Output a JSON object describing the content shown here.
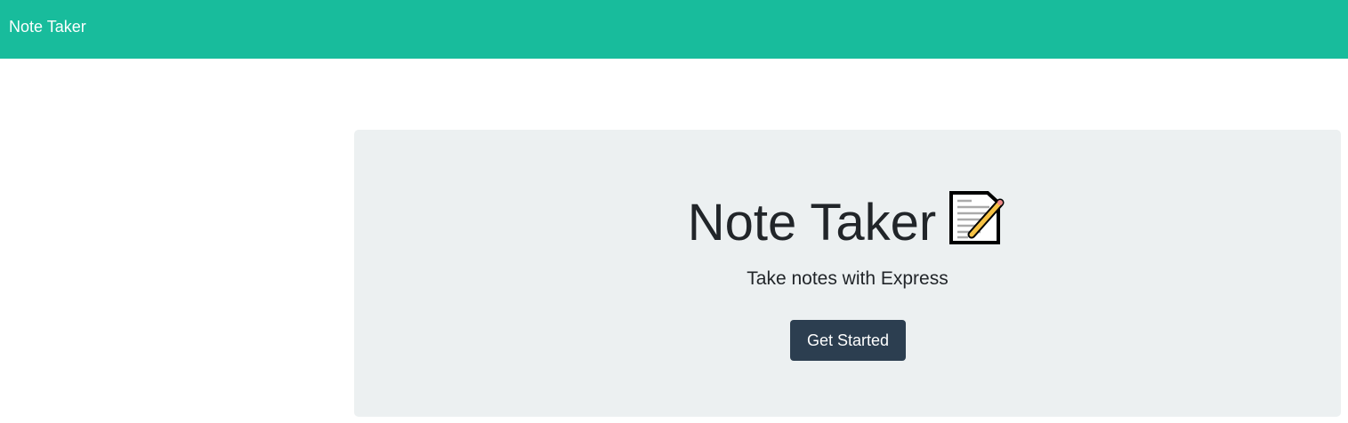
{
  "navbar": {
    "brand": "Note Taker",
    "color": "#18bc9c"
  },
  "hero": {
    "title": "Note Taker",
    "title_icon": "memo-icon",
    "subtitle": "Take notes with Express",
    "button_label": "Get Started",
    "button_color": "#2c3e50",
    "background": "#ecf0f1"
  }
}
